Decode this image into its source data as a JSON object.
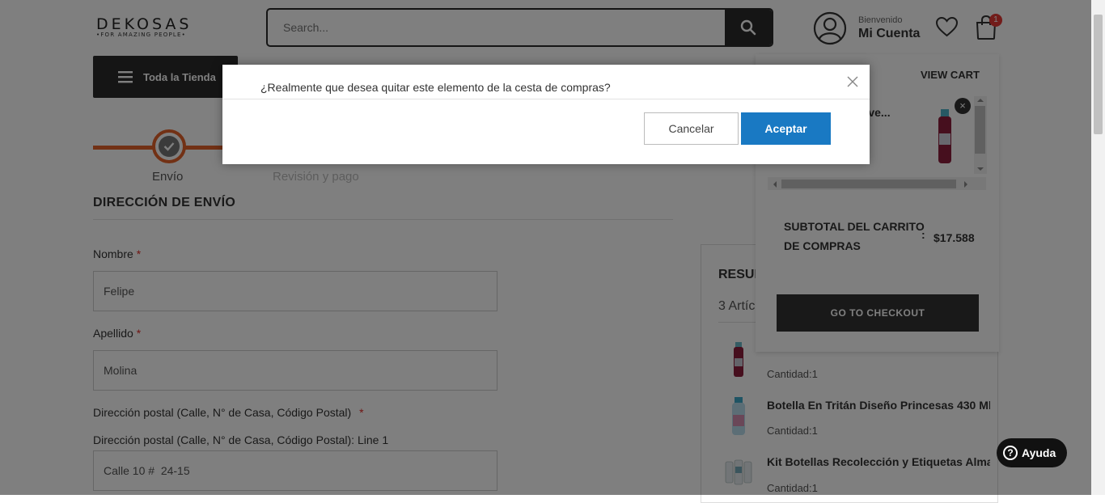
{
  "header": {
    "logo_main": "DEKOSAS",
    "logo_sub": "•FOR AMAZING PEOPLE•",
    "search_placeholder": "Search...",
    "account_greeting": "Bienvenido",
    "account_label": "Mi Cuenta",
    "cart_count": "1",
    "icons": [
      "search-icon",
      "user-icon",
      "heart-icon",
      "shopping-bag-icon"
    ]
  },
  "nav": {
    "all_store_label": "Toda la Tienda"
  },
  "progress": {
    "step1_label": "Envío",
    "step2_label": "Revisión y pago",
    "accent_color": "#e5632a"
  },
  "shipping": {
    "title": "DIRECCIÓN DE ENVÍO",
    "first_name_label": "Nombre",
    "first_name_value": "Felipe",
    "last_name_label": "Apellido",
    "last_name_value": "Molina",
    "address_label": "Dirección postal (Calle, N° de Casa, Código Postal)",
    "address_line1_label": "Dirección postal (Calle, N° de Casa, Código Postal): Line 1",
    "address_line1_value": "Calle 10 #  24-15",
    "required_mark": "*"
  },
  "summary": {
    "title": "RESUM",
    "count_text": "3 Artíc",
    "items": [
      {
        "name": "",
        "qty": "Cantidad:1"
      },
      {
        "name": "Botella En Tritán Diseño Princesas 430 Ml",
        "qty": "Cantidad:1"
      },
      {
        "name": "Kit Botellas Recolección y Etiquetas Almac",
        "qty": "Cantidad:1"
      }
    ]
  },
  "minicart": {
    "view_cart": "VIEW CART",
    "item_name": "ctive...",
    "subtotal_label": "SUBTOTAL DEL CARRITO DE COMPRAS",
    "subtotal_colon": ":",
    "subtotal_value": "$17.588",
    "checkout_label": "GO TO CHECKOUT",
    "remove_glyph": "×"
  },
  "modal": {
    "message": "¿Realmente que desea quitar este elemento de la cesta de compras?",
    "cancel_label": "Cancelar",
    "accept_label": "Aceptar",
    "accept_color": "#1979c3"
  },
  "help": {
    "label": "Ayuda",
    "glyph": "?"
  }
}
